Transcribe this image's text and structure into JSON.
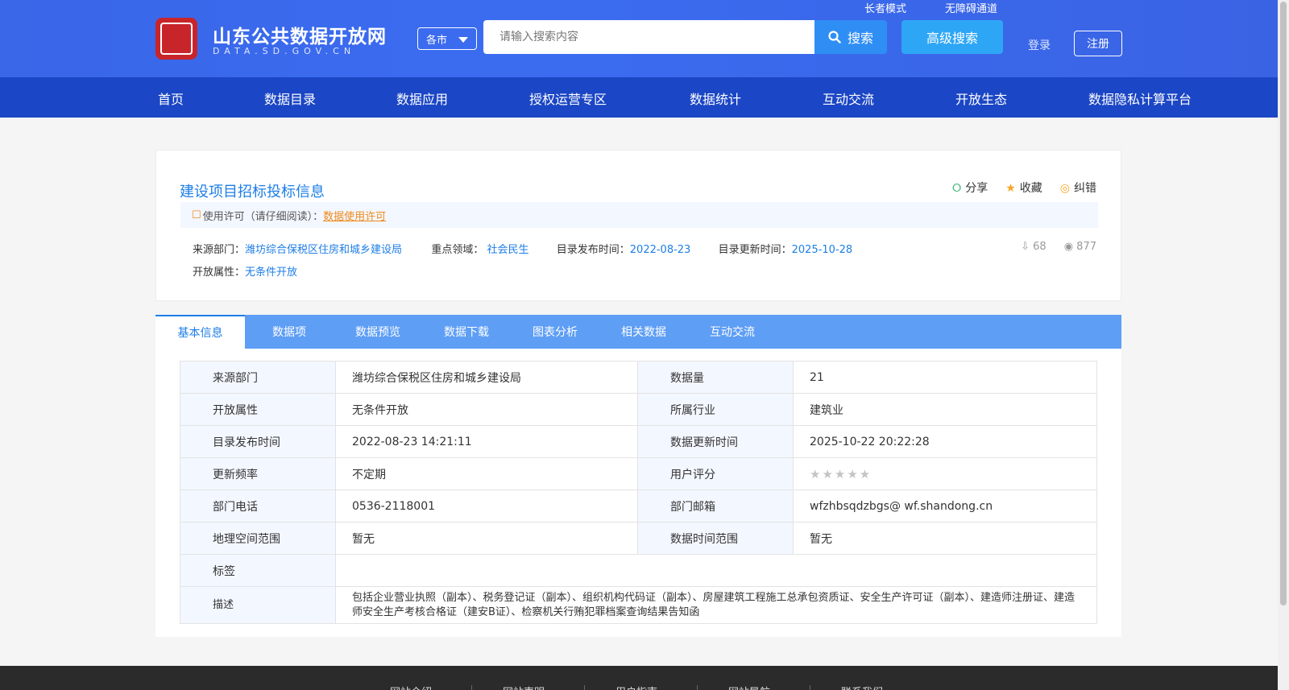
{
  "header": {
    "site_title": "山东公共数据开放网",
    "site_domain": "DATA.SD.GOV.CN",
    "city_select": "各市",
    "search_placeholder": "请输入搜索内容",
    "search_button": "搜索",
    "advanced_search": "高级搜索",
    "elder_mode": "长者模式",
    "accessibility": "无障碍通道",
    "login": "登录",
    "register": "注册"
  },
  "nav": [
    "首页",
    "数据目录",
    "数据应用",
    "授权运营专区",
    "数据统计",
    "互动交流",
    "开放生态",
    "数据隐私计算平台"
  ],
  "dataset": {
    "title": "建设项目招标投标信息",
    "share": "分享",
    "favorite": "收藏",
    "correction": "纠错",
    "license_label": "使用许可（请仔细阅读）：",
    "license_link": "数据使用许可",
    "source_label": "来源部门：",
    "source_value": "潍坊综合保税区住房和城乡建设局",
    "domain_label": "重点领域：",
    "domain_value": "社会民生",
    "publish_label": "目录发布时间：",
    "publish_value": "2022-08-23",
    "update_label": "目录更新时间：",
    "update_value": "2025-10-28",
    "open_label": "开放属性：",
    "open_value": "无条件开放",
    "downloads": "68",
    "views": "877"
  },
  "tabs": [
    "基本信息",
    "数据项",
    "数据预览",
    "数据下载",
    "图表分析",
    "相关数据",
    "互动交流"
  ],
  "info": {
    "rows": [
      {
        "l1": "来源部门",
        "v1": "潍坊综合保税区住房和城乡建设局",
        "l2": "数据量",
        "v2": "21"
      },
      {
        "l1": "开放属性",
        "v1": "无条件开放",
        "l2": "所属行业",
        "v2": "建筑业"
      },
      {
        "l1": "目录发布时间",
        "v1": "2022-08-23 14:21:11",
        "l2": "数据更新时间",
        "v2": "2025-10-22 20:22:28"
      },
      {
        "l1": "更新频率",
        "v1": "不定期",
        "l2": "用户评分",
        "v2": ""
      },
      {
        "l1": "部门电话",
        "v1": "0536-2118001",
        "l2": "部门邮箱",
        "v2": "wfzhbsqdzbgs@ wf.shandong.cn"
      },
      {
        "l1": "地理空间范围",
        "v1": "暂无",
        "l2": "数据时间范围",
        "v2": "暂无"
      }
    ],
    "tag_label": "标签",
    "tag_value": "",
    "desc_label": "描述",
    "desc_value": "包括企业营业执照（副本）、税务登记证（副本）、组织机构代码证（副本）、房屋建筑工程施工总承包资质证、安全生产许可证（副本）、建造师注册证、建造师安全生产考核合格证（建安B证）、检察机关行贿犯罪档案查询结果告知函",
    "rating": 0
  },
  "footer": [
    "网站介绍",
    "网站声明",
    "用户指南",
    "网站导航",
    "联系我们"
  ]
}
